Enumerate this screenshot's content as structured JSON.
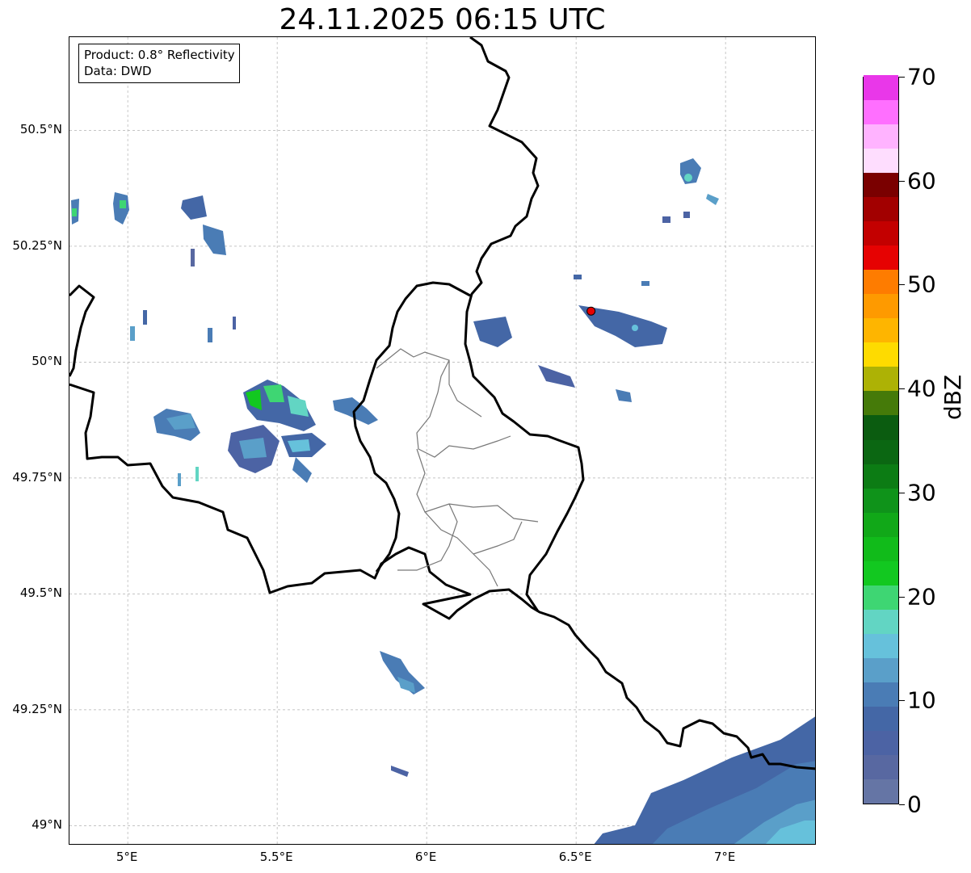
{
  "title": "24.11.2025 06:15 UTC",
  "info_box": {
    "product": "Product: 0.8° Reflectivity",
    "source": "Data: DWD"
  },
  "lat_ticks": [
    {
      "label": "50.5°N",
      "value": 50.5
    },
    {
      "label": "50.25°N",
      "value": 50.25
    },
    {
      "label": "50°N",
      "value": 50.0
    },
    {
      "label": "49.75°N",
      "value": 49.75
    },
    {
      "label": "49.5°N",
      "value": 49.5
    },
    {
      "label": "49.25°N",
      "value": 49.25
    },
    {
      "label": "49°N",
      "value": 49.0
    }
  ],
  "lon_ticks": [
    {
      "label": "5°E",
      "value": 5.0
    },
    {
      "label": "5.5°E",
      "value": 5.5
    },
    {
      "label": "6°E",
      "value": 6.0
    },
    {
      "label": "6.5°E",
      "value": 6.5
    },
    {
      "label": "7°E",
      "value": 7.0
    }
  ],
  "colorbar": {
    "unit": "dBZ",
    "ticks": [
      "0",
      "10",
      "20",
      "30",
      "40",
      "50",
      "60",
      "70"
    ],
    "colors": [
      "#6575a5",
      "#5868a1",
      "#4c63a4",
      "#4467a6",
      "#4a7cb5",
      "#5a9fc9",
      "#66c1db",
      "#62d5c3",
      "#3ed673",
      "#12c820",
      "#11bb1a",
      "#11a818",
      "#0f931a",
      "#0c7c14",
      "#0b6712",
      "#0b5c10",
      "#457a09",
      "#adb205",
      "#fedb00",
      "#feb500",
      "#fe9a00",
      "#fe7c00",
      "#e60202",
      "#c30000",
      "#a20000",
      "#7a0000",
      "#feddfe",
      "#ffb3ff",
      "#ff6fff",
      "#e937e9"
    ]
  },
  "radar_marker": {
    "lon": 6.55,
    "lat": 50.11,
    "color": "#e60000"
  }
}
